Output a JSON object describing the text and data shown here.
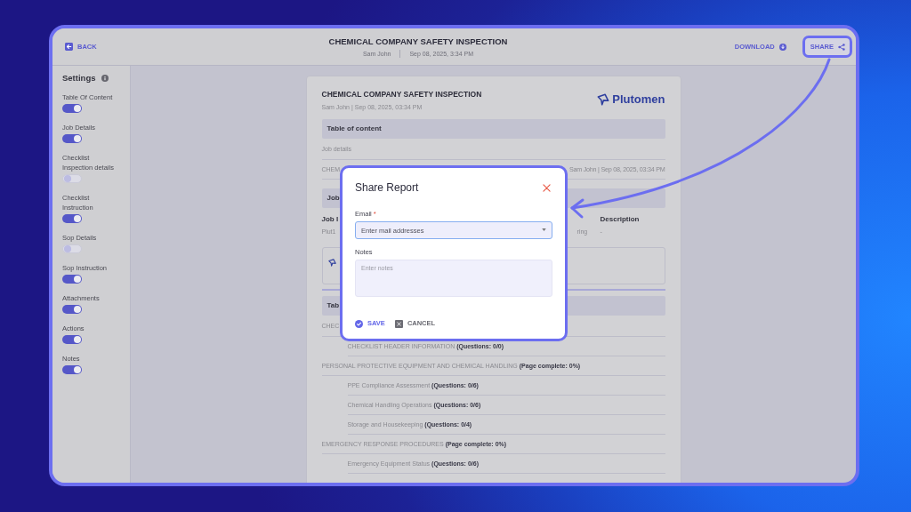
{
  "top_bar": {
    "back": "BACK",
    "title": "CHEMICAL COMPANY SAFETY INSPECTION",
    "author": "Sam John",
    "date": "Sep 08, 2025, 3:34 PM",
    "actions": [
      {
        "label": "DOWNLOAD",
        "kind": "download",
        "highlighted": false
      },
      {
        "label": "SHARE",
        "kind": "share",
        "highlighted": true
      }
    ]
  },
  "sidebar": {
    "title": "Settings",
    "settings": [
      {
        "label": "Table Of Content",
        "on": true
      },
      {
        "label": "Job Details",
        "on": true
      },
      {
        "label": "Checklist Inspection details",
        "on": false
      },
      {
        "label": "Checklist Instruction",
        "on": true
      },
      {
        "label": "Sop Details",
        "on": false
      },
      {
        "label": "Sop Instruction",
        "on": true
      },
      {
        "label": "Attachments",
        "on": true
      },
      {
        "label": "Actions",
        "on": true
      },
      {
        "label": "Notes",
        "on": true
      }
    ]
  },
  "report": {
    "title": "CHEMICAL COMPANY SAFETY INSPECTION",
    "meta": "Sam John | Sep 08, 2025, 03:34 PM",
    "logo": "Plutomen",
    "blocks": [
      {
        "kind": "heading",
        "text": "Table of content"
      },
      {
        "kind": "row",
        "text": "Job details"
      },
      {
        "kind": "row",
        "text": "CHEM",
        "aside": "Sam John | Sep 08, 2025, 03:34 PM"
      },
      {
        "kind": "heading",
        "text": "Job"
      },
      {
        "kind": "fields",
        "columns": [
          {
            "label": "Job I",
            "value": "Plut1"
          },
          {
            "value": "ring"
          },
          {
            "label": "Description",
            "value": "-"
          }
        ]
      },
      {
        "kind": "attachment"
      },
      {
        "kind": "rule"
      },
      {
        "kind": "heading",
        "text": "Tab"
      },
      {
        "kind": "row",
        "text": "CHEC"
      },
      {
        "kind": "subrow",
        "text": "CHECKLIST HEADER INFORMATION **(Questions: 0/0)**"
      },
      {
        "kind": "row",
        "text": "PERSONAL PROTECTIVE EQUIPMENT AND CHEMICAL HANDLING **(Page complete: 0%)**"
      },
      {
        "kind": "subrow",
        "text": "PPE Compliance Assessment **(Questions: 0/6)**"
      },
      {
        "kind": "subrow",
        "text": "Chemical Handling Operations **(Questions: 0/6)**"
      },
      {
        "kind": "subrow",
        "text": "Storage and Housekeeping **(Questions: 0/4)**"
      },
      {
        "kind": "row",
        "text": "EMERGENCY RESPONSE PROCEDURES **(Page complete: 0%)**"
      },
      {
        "kind": "subrow",
        "text": "Emergency Equipment Status **(Questions: 0/6)**"
      }
    ]
  },
  "dialog": {
    "title": "Share Report",
    "fields": [
      {
        "kind": "select",
        "label": "Email",
        "required_mark": "*",
        "placeholder": "Enter mail addresses",
        "focused": true
      },
      {
        "kind": "textarea",
        "label": "Notes",
        "placeholder": "Enter notes",
        "focused": false
      }
    ],
    "buttons": [
      {
        "kind": "primary",
        "label": "SAVE"
      },
      {
        "kind": "secondary",
        "label": "CANCEL"
      }
    ]
  }
}
